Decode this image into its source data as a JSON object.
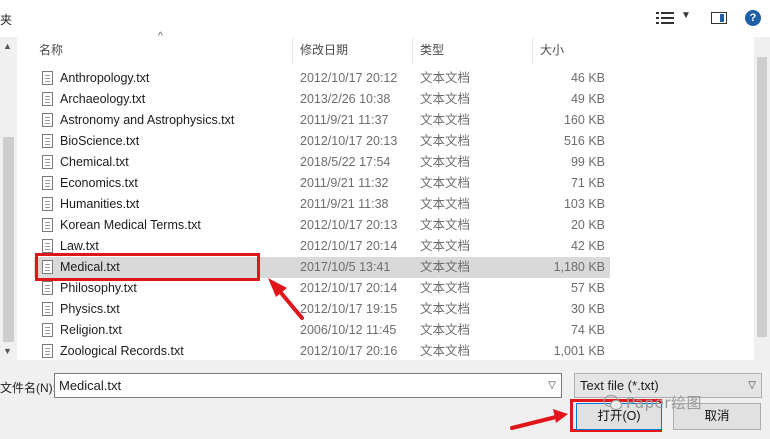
{
  "window": {
    "title_fragment": "夹"
  },
  "columns": {
    "name": "名称",
    "date": "修改日期",
    "type": "类型",
    "size": "大小"
  },
  "files": [
    {
      "name": "Anthropology.txt",
      "date": "2012/10/17 20:12",
      "type": "文本文档",
      "size": "46 KB"
    },
    {
      "name": "Archaeology.txt",
      "date": "2013/2/26 10:38",
      "type": "文本文档",
      "size": "49 KB"
    },
    {
      "name": "Astronomy and Astrophysics.txt",
      "date": "2011/9/21 11:37",
      "type": "文本文档",
      "size": "160 KB"
    },
    {
      "name": "BioScience.txt",
      "date": "2012/10/17 20:13",
      "type": "文本文档",
      "size": "516 KB"
    },
    {
      "name": "Chemical.txt",
      "date": "2018/5/22 17:54",
      "type": "文本文档",
      "size": "99 KB"
    },
    {
      "name": "Economics.txt",
      "date": "2011/9/21 11:32",
      "type": "文本文档",
      "size": "71 KB"
    },
    {
      "name": "Humanities.txt",
      "date": "2011/9/21 11:38",
      "type": "文本文档",
      "size": "103 KB"
    },
    {
      "name": "Korean Medical Terms.txt",
      "date": "2012/10/17 20:13",
      "type": "文本文档",
      "size": "20 KB"
    },
    {
      "name": "Law.txt",
      "date": "2012/10/17 20:14",
      "type": "文本文档",
      "size": "42 KB"
    },
    {
      "name": "Medical.txt",
      "date": "2017/10/5 13:41",
      "type": "文本文档",
      "size": "1,180 KB",
      "selected": true
    },
    {
      "name": "Philosophy.txt",
      "date": "2012/10/17 20:14",
      "type": "文本文档",
      "size": "57 KB"
    },
    {
      "name": "Physics.txt",
      "date": "2012/10/17 19:15",
      "type": "文本文档",
      "size": "30 KB"
    },
    {
      "name": "Religion.txt",
      "date": "2006/10/12 11:45",
      "type": "文本文档",
      "size": "74 KB"
    },
    {
      "name": "Zoological Records.txt",
      "date": "2012/10/17 20:16",
      "type": "文本文档",
      "size": "1,001 KB"
    }
  ],
  "filename": {
    "label": "文件名(N):",
    "value": "Medical.txt"
  },
  "filetype": {
    "selected": "Text file  (*.txt)"
  },
  "buttons": {
    "open": "打开(O)",
    "cancel": "取消"
  },
  "watermark": "Paper绘图",
  "colors": {
    "annotation_red": "#e0161b",
    "selected_row": "#d9d9d9",
    "accent_blue": "#0078d7"
  }
}
